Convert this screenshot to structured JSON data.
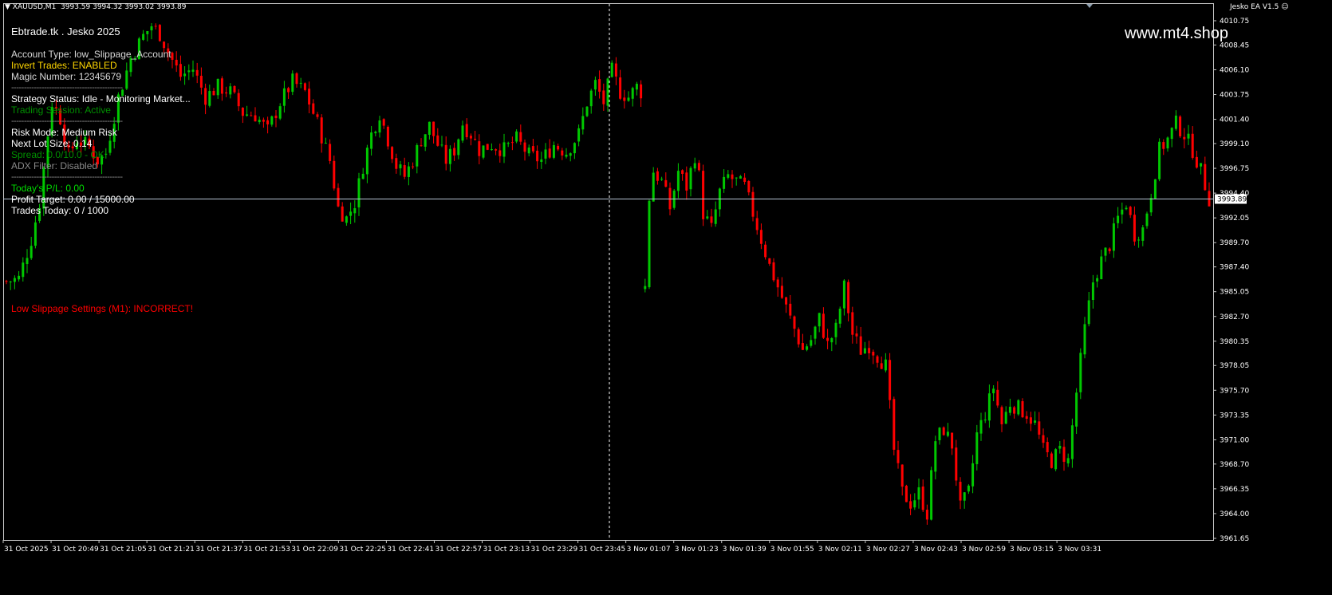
{
  "symbol_bar": {
    "symbol": "XAUUSD,M1",
    "prices": "3993.59 3994.32 3993.02 3993.89"
  },
  "ea_label": "Jesko EA V1.5",
  "ea_icon": "smiley-icon",
  "watermark": "www.mt4.shop",
  "colors": {
    "background": "#000000",
    "bull_candle": "#00c800",
    "bear_candle": "#ff0000",
    "axis_text": "#ffffff",
    "bid_line": "#b4c3d2",
    "panel_white": "#ffffff",
    "panel_yellow": "#ffd700",
    "panel_green_bright": "#00dd00",
    "panel_green_dim": "#008f00",
    "panel_gray": "#8a8a8a",
    "warning_red": "#ff0000"
  },
  "panel": {
    "brand": "Ebtrade.tk . Jesko 2025",
    "account_type": "Account Type:  low_Slippage_Account",
    "invert_trades": "Invert Trades:  ENABLED",
    "magic_number": "Magic Number:  12345679",
    "separator": "------------------------------------------------",
    "strategy_status": "Strategy Status: Idle - Monitoring Market...",
    "trading_session": "Trading Session: Active",
    "risk_mode": "Risk Mode:         Medium Risk",
    "next_lot_size": "Next Lot Size:  0.14",
    "spread": "Spread:          0.0/10.0 - OK",
    "adx_filter": "ADX Filter:       Disabled",
    "todays_pl": "Today's P/L:    0.00",
    "profit_target": "Profit Target:  0.00 / 15000.00",
    "trades_today": "Trades Today:   0 / 1000",
    "warning": "Low Slippage Settings (M1): INCORRECT!"
  },
  "chart_data": {
    "type": "candlestick",
    "instrument": "XAUUSD",
    "timeframe": "M1",
    "current_price": "3993.89",
    "y_ticks": [
      "4010.75",
      "4008.45",
      "4006.10",
      "4003.75",
      "4001.40",
      "3999.10",
      "3996.75",
      "3994.40",
      "3992.05",
      "3989.70",
      "3987.40",
      "3985.05",
      "3982.70",
      "3980.35",
      "3978.05",
      "3975.70",
      "3973.35",
      "3971.00",
      "3968.70",
      "3966.35",
      "3964.00",
      "3961.65"
    ],
    "ylim": [
      3961.65,
      4010.75
    ],
    "x_ticks": [
      "31 Oct 2025",
      "31 Oct 20:49",
      "31 Oct 21:05",
      "31 Oct 21:21",
      "31 Oct 21:37",
      "31 Oct 21:53",
      "31 Oct 22:09",
      "31 Oct 22:25",
      "31 Oct 22:41",
      "31 Oct 22:57",
      "31 Oct 23:13",
      "31 Oct 23:29",
      "31 Oct 23:45",
      "3 Nov 01:07",
      "3 Nov 01:23",
      "3 Nov 01:39",
      "3 Nov 01:55",
      "3 Nov 02:11",
      "3 Nov 02:27",
      "3 Nov 02:43",
      "3 Nov 02:59",
      "3 Nov 03:15",
      "3 Nov 03:31"
    ],
    "session_break_after_tick": 12,
    "close_path": [
      [
        0,
        3986.0
      ],
      [
        3,
        3986.3
      ],
      [
        6,
        3990.0
      ],
      [
        8,
        3993.5
      ],
      [
        10,
        4000.0
      ],
      [
        11,
        4003.0
      ],
      [
        13,
        4001.5
      ],
      [
        15,
        3998.0
      ],
      [
        17,
        3999.5
      ],
      [
        20,
        3998.8
      ],
      [
        22,
        3997.5
      ],
      [
        24,
        3998.2
      ],
      [
        27,
        4003.5
      ],
      [
        30,
        4007.2
      ],
      [
        33,
        4009.3
      ],
      [
        35,
        4010.3
      ],
      [
        37,
        4009.5
      ],
      [
        40,
        4007.0
      ],
      [
        42,
        4005.5
      ],
      [
        45,
        4006.2
      ],
      [
        48,
        4003.5
      ],
      [
        51,
        4004.5
      ],
      [
        54,
        4004.0
      ],
      [
        57,
        4002.0
      ],
      [
        60,
        4001.8
      ],
      [
        63,
        4000.3
      ],
      [
        66,
        4003.0
      ],
      [
        69,
        4005.0
      ],
      [
        72,
        4004.0
      ],
      [
        75,
        4001.0
      ],
      [
        78,
        3997.5
      ],
      [
        80,
        3993.0
      ],
      [
        82,
        3992.0
      ],
      [
        84,
        3993.5
      ],
      [
        86,
        3997.0
      ],
      [
        88,
        4000.0
      ],
      [
        90,
        4002.0
      ],
      [
        92,
        3999.5
      ],
      [
        94,
        3997.0
      ],
      [
        96,
        3996.0
      ],
      [
        98,
        3997.5
      ],
      [
        100,
        3999.5
      ],
      [
        102,
        4000.8
      ],
      [
        104,
        3999.0
      ],
      [
        106,
        3997.5
      ],
      [
        108,
        3998.5
      ],
      [
        110,
        4001.0
      ],
      [
        112,
        4000.0
      ],
      [
        114,
        3998.5
      ],
      [
        117,
        3999.0
      ],
      [
        120,
        3998.5
      ],
      [
        123,
        3999.5
      ],
      [
        126,
        3998.0
      ],
      [
        129,
        3997.5
      ],
      [
        132,
        3999.0
      ],
      [
        135,
        3998.3
      ],
      [
        138,
        4000.0
      ],
      [
        140,
        4003.0
      ],
      [
        142,
        4004.8
      ],
      [
        144,
        4003.0
      ],
      [
        146,
        4006.0
      ],
      [
        148,
        4004.0
      ],
      [
        150,
        4003.5
      ],
      [
        152,
        4004.5
      ],
      [
        153,
        4004.0
      ]
    ],
    "close_path_2": [
      [
        154,
        3985.5
      ],
      [
        155,
        3994.0
      ],
      [
        156,
        3996.5
      ],
      [
        158,
        3995.5
      ],
      [
        160,
        3993.0
      ],
      [
        162,
        3996.5
      ],
      [
        164,
        3995.0
      ],
      [
        166,
        3998.0
      ],
      [
        167,
        3996.0
      ],
      [
        168,
        3992.5
      ],
      [
        170,
        3991.0
      ],
      [
        172,
        3994.5
      ],
      [
        174,
        3996.0
      ],
      [
        176,
        3995.5
      ],
      [
        178,
        3995.0
      ],
      [
        180,
        3992.5
      ],
      [
        182,
        3990.0
      ],
      [
        184,
        3987.5
      ],
      [
        186,
        3985.5
      ],
      [
        188,
        3983.5
      ],
      [
        190,
        3981.5
      ],
      [
        192,
        3979.5
      ],
      [
        194,
        3980.5
      ],
      [
        196,
        3982.5
      ],
      [
        198,
        3980.0
      ],
      [
        200,
        3981.5
      ],
      [
        202,
        3985.5
      ],
      [
        204,
        3981.0
      ],
      [
        206,
        3979.5
      ],
      [
        208,
        3980.0
      ],
      [
        210,
        3979.0
      ],
      [
        212,
        3978.0
      ],
      [
        214,
        3970.0
      ],
      [
        216,
        3966.0
      ],
      [
        218,
        3965.0
      ],
      [
        220,
        3966.0
      ],
      [
        222,
        3964.0
      ],
      [
        224,
        3971.0
      ],
      [
        226,
        3972.0
      ],
      [
        228,
        3970.5
      ],
      [
        230,
        3964.5
      ],
      [
        232,
        3966.0
      ],
      [
        234,
        3971.5
      ],
      [
        236,
        3973.5
      ],
      [
        238,
        3976.0
      ],
      [
        240,
        3972.5
      ],
      [
        242,
        3974.5
      ],
      [
        244,
        3974.0
      ],
      [
        246,
        3973.5
      ],
      [
        248,
        3972.5
      ],
      [
        250,
        3970.0
      ],
      [
        252,
        3969.0
      ],
      [
        254,
        3970.0
      ],
      [
        256,
        3969.0
      ],
      [
        258,
        3975.5
      ],
      [
        260,
        3981.5
      ],
      [
        262,
        3986.0
      ],
      [
        264,
        3988.0
      ],
      [
        266,
        3989.5
      ],
      [
        268,
        3992.0
      ],
      [
        270,
        3993.5
      ],
      [
        272,
        3990.5
      ],
      [
        274,
        3991.0
      ],
      [
        276,
        3994.5
      ],
      [
        278,
        3998.5
      ],
      [
        280,
        3999.5
      ],
      [
        282,
        4001.0
      ],
      [
        284,
        4000.0
      ],
      [
        286,
        3998.5
      ],
      [
        288,
        3996.5
      ],
      [
        290,
        3993.89
      ]
    ]
  }
}
